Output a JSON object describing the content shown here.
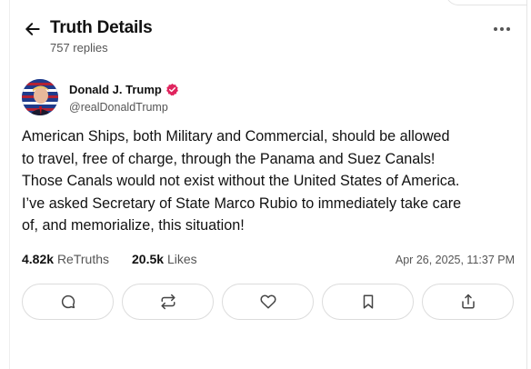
{
  "header": {
    "title": "Truth Details",
    "replies": "757 replies"
  },
  "author": {
    "name": "Donald J. Trump",
    "handle": "@realDonaldTrump",
    "verified": true
  },
  "post": {
    "text": "American Ships, both Military and Commercial, should be allowed\nto travel, free of charge, through the Panama and Suez Canals!\nThose Canals would not exist without the United States of America.\nI’ve asked Secretary of State Marco Rubio to immediately take care\nof, and memorialize, this situation!"
  },
  "stats": {
    "retruths_count": "4.82k",
    "retruths_label": "ReTruths",
    "likes_count": "20.5k",
    "likes_label": "Likes",
    "timestamp": "Apr 26, 2025, 11:37 PM"
  },
  "colors": {
    "text": "#111111",
    "muted": "#555555",
    "border": "#dcdcdc",
    "verified_badge": "#e0245e"
  },
  "actions": [
    "reply-icon",
    "retruth-icon",
    "like-icon",
    "bookmark-icon",
    "share-icon"
  ]
}
